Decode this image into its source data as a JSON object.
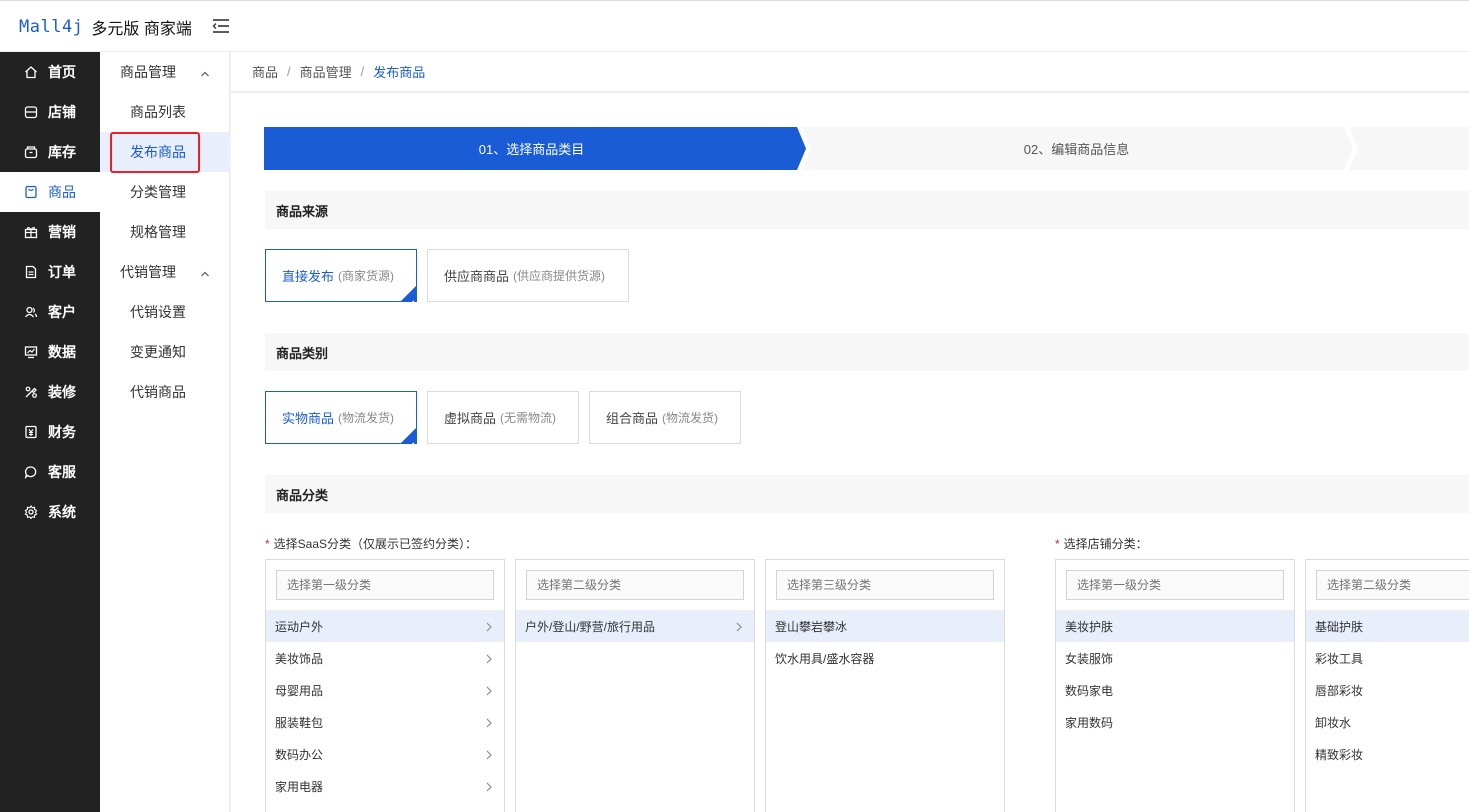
{
  "header": {
    "logo_mark": "Mall4j",
    "logo_text": "多元版 商家端"
  },
  "sidebar": {
    "items": [
      {
        "label": "首页",
        "icon": "home-icon"
      },
      {
        "label": "店铺",
        "icon": "shop-icon"
      },
      {
        "label": "库存",
        "icon": "inventory-icon"
      },
      {
        "label": "商品",
        "icon": "product-icon"
      },
      {
        "label": "营销",
        "icon": "gift-icon"
      },
      {
        "label": "订单",
        "icon": "order-icon"
      },
      {
        "label": "客户",
        "icon": "customer-icon"
      },
      {
        "label": "数据",
        "icon": "data-icon"
      },
      {
        "label": "装修",
        "icon": "decorate-icon"
      },
      {
        "label": "财务",
        "icon": "finance-icon"
      },
      {
        "label": "客服",
        "icon": "chat-icon"
      },
      {
        "label": "系统",
        "icon": "settings-icon"
      }
    ],
    "active_index": 3
  },
  "submenu": {
    "group1": "商品管理",
    "items1": [
      "商品列表",
      "发布商品",
      "分类管理",
      "规格管理"
    ],
    "group2": "代销管理",
    "items2": [
      "代销设置",
      "变更通知",
      "代销商品"
    ],
    "active": "发布商品"
  },
  "breadcrumb": {
    "items": [
      "商品",
      "商品管理"
    ],
    "current": "发布商品"
  },
  "steps": {
    "step1": "01、选择商品类目",
    "step2": "02、编辑商品信息"
  },
  "colors": {
    "accent": "#1a5cd6",
    "sidebar_bg": "#222222",
    "highlight_red": "#e5222a"
  },
  "source": {
    "title": "商品来源",
    "options": [
      {
        "label": "直接发布",
        "hint": "(商家货源)",
        "selected": true
      },
      {
        "label": "供应商商品",
        "hint": "(供应商提供货源)",
        "selected": false
      }
    ]
  },
  "product_type": {
    "title": "商品类别",
    "options": [
      {
        "label": "实物商品",
        "hint": "(物流发货)",
        "selected": true
      },
      {
        "label": "虚拟商品",
        "hint": "(无需物流)",
        "selected": false
      },
      {
        "label": "组合商品",
        "hint": "(物流发货)",
        "selected": false
      }
    ]
  },
  "category": {
    "title": "商品分类",
    "saas_label": "选择SaaS分类（仅展示已签约分类）：",
    "shop_label": "选择店铺分类：",
    "saas_level1": {
      "placeholder": "选择第一级分类",
      "items": [
        "运动户外",
        "美妆饰品",
        "母婴用品",
        "服装鞋包",
        "数码办公",
        "家用电器"
      ],
      "selected": 0
    },
    "saas_level2": {
      "placeholder": "选择第二级分类",
      "items": [
        "户外/登山/野营/旅行用品"
      ],
      "selected": 0
    },
    "saas_level3": {
      "placeholder": "选择第三级分类",
      "items": [
        "登山攀岩攀冰",
        "饮水用具/盛水容器"
      ],
      "selected": 0
    },
    "shop_level1": {
      "placeholder": "选择第一级分类",
      "items": [
        "美妆护肤",
        "女装服饰",
        "数码家电",
        "家用数码"
      ],
      "selected": 0
    },
    "shop_level2": {
      "placeholder": "选择第二级分类",
      "items": [
        "基础护肤",
        "彩妆工具",
        "唇部彩妆",
        "卸妆水",
        "精致彩妆"
      ],
      "selected": 0
    }
  }
}
